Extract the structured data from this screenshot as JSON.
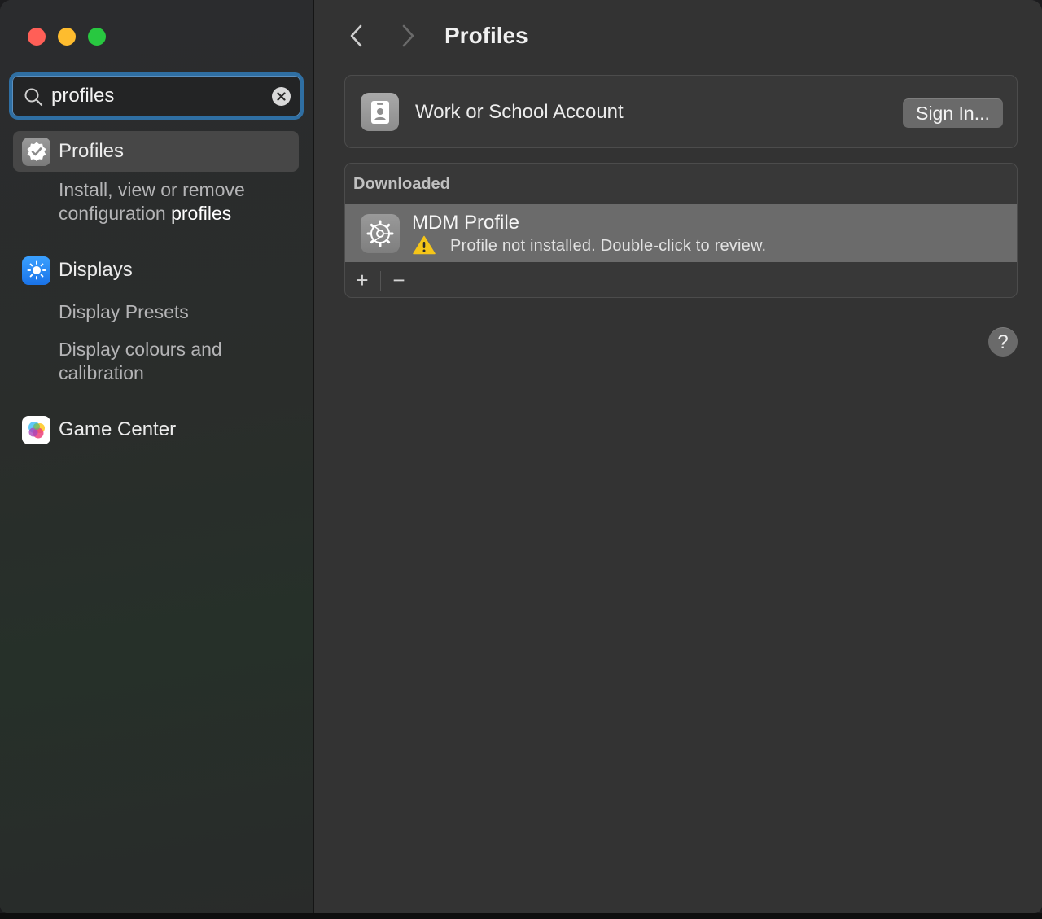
{
  "colors": {
    "accent_focus": "#2f6fa3",
    "traffic_red": "#ff5f57",
    "traffic_yellow": "#febc2e",
    "traffic_green": "#28c840",
    "warning": "#f5c518"
  },
  "search": {
    "value": "profiles",
    "icon": "magnifying-glass-icon",
    "clear_icon": "clear-x-icon"
  },
  "sidebar": {
    "items": [
      {
        "label": "Profiles",
        "icon": "checkmark-seal-icon",
        "selected": true,
        "sub_prefix": "Install, view or remove configuration ",
        "sub_highlight": "profiles"
      },
      {
        "label": "Displays",
        "icon": "sun-icon",
        "subs": [
          "Display Presets",
          "Display colours and calibration"
        ]
      },
      {
        "label": "Game Center",
        "icon": "game-center-icon"
      }
    ]
  },
  "header": {
    "title": "Profiles",
    "back_icon": "chevron-left-icon",
    "forward_icon": "chevron-right-icon"
  },
  "account": {
    "label": "Work or School Account",
    "icon": "id-badge-icon",
    "button": "Sign In..."
  },
  "downloaded": {
    "header": "Downloaded",
    "profile_name": "MDM Profile",
    "profile_icon": "gear-icon",
    "status": "Profile not installed. Double-click to review.",
    "status_icon": "warning-triangle-icon",
    "add_label": "+",
    "remove_label": "−"
  },
  "help": {
    "label": "?"
  }
}
